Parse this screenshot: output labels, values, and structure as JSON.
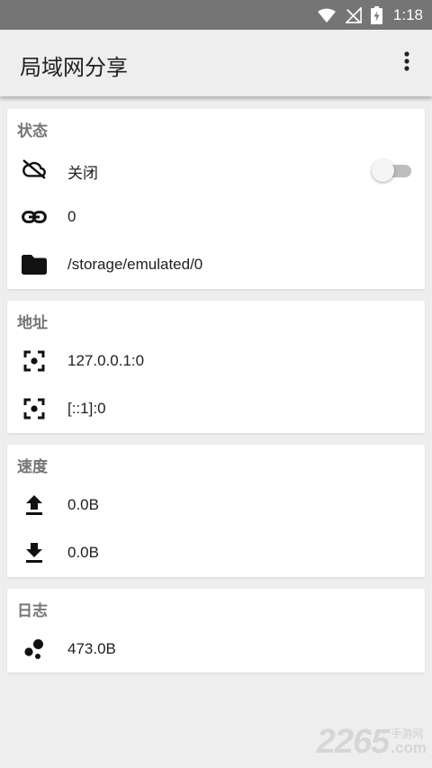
{
  "status_bar": {
    "time": "1:18",
    "icons": [
      "wifi-icon",
      "no-signal-icon",
      "battery-charging-icon"
    ]
  },
  "app_bar": {
    "title": "局域网分享",
    "menu_icon": "more-vert-icon"
  },
  "sections": {
    "status": {
      "title": "状态",
      "share_state": "关闭",
      "share_enabled": false,
      "connections": "0",
      "shared_path": "/storage/emulated/0"
    },
    "address": {
      "title": "地址",
      "ipv4": "127.0.0.1:0",
      "ipv6": "[::1]:0"
    },
    "speed": {
      "title": "速度",
      "upload": "0.0B",
      "download": "0.0B"
    },
    "log": {
      "title": "日志",
      "size": "473.0B"
    }
  },
  "watermark": {
    "number": "2265",
    "chinese": "手游网",
    "suffix": ".com"
  },
  "colors": {
    "status_bar": "#757575",
    "background": "#eeeeee",
    "card": "#ffffff",
    "section_title": "#757575",
    "toggle_track": "#bdbdbd"
  }
}
